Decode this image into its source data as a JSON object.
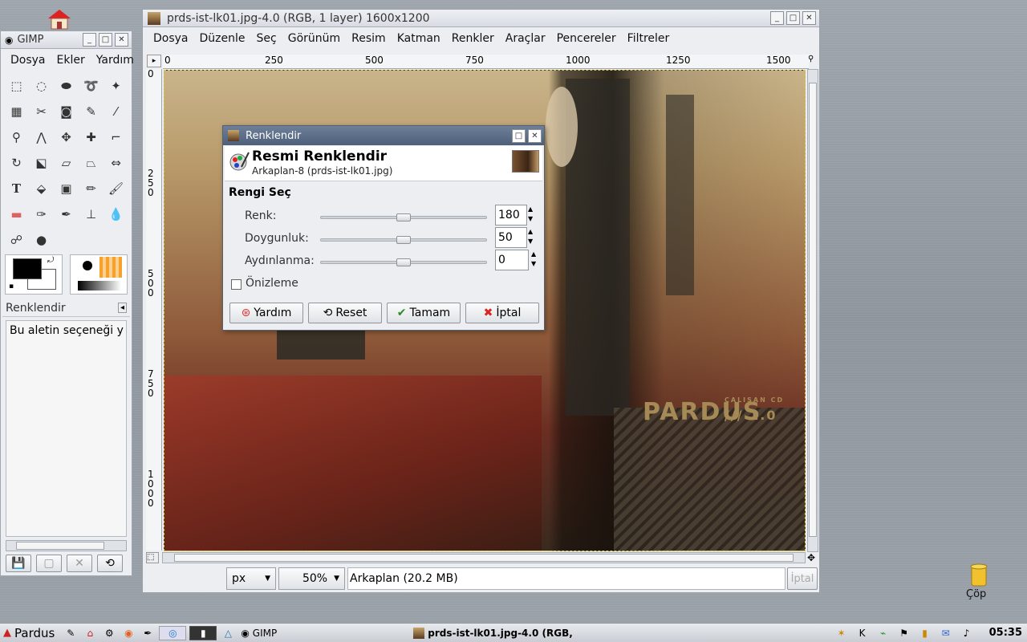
{
  "desktop": {
    "trash_label": "Çöp"
  },
  "toolbox": {
    "title": "GIMP",
    "menu": [
      "Dosya",
      "Ekler",
      "Yardım"
    ],
    "fg_color": "#000000",
    "bg_color": "#ffffff",
    "tool_options_title": "Renklendir",
    "tool_options_text": "Bu aletin seçeneği y"
  },
  "image_window": {
    "title": "prds-ist-lk01.jpg-4.0 (RGB, 1 layer) 1600x1200",
    "menu": [
      "Dosya",
      "Düzenle",
      "Seç",
      "Görünüm",
      "Resim",
      "Katman",
      "Renkler",
      "Araçlar",
      "Pencereler",
      "Filtreler"
    ],
    "ruler_h": [
      "0",
      "250",
      "500",
      "750",
      "1000",
      "1250",
      "1500"
    ],
    "ruler_v": [
      "0",
      "250",
      "500",
      "750",
      "1000"
    ],
    "unit": "px",
    "zoom": "50%",
    "status": "Arkaplan (20.2 MB)",
    "cancel": "İptal",
    "logo_text": "PARDUS",
    "logo_sub": "ÇALIŞAN CD",
    "logo_version": "/// 1.0"
  },
  "dialog": {
    "title": "Renklendir",
    "heading": "Resmi Renklendir",
    "subheading": "Arkaplan-8 (prds-ist-lk01.jpg)",
    "section": "Rengi Seç",
    "sliders": [
      {
        "label": "Renk:",
        "value": "180"
      },
      {
        "label": "Doygunluk:",
        "value": "50"
      },
      {
        "label": "Aydınlanma:",
        "value": "0"
      }
    ],
    "preview_label": "Önizleme",
    "buttons": {
      "help": "Yardım",
      "reset": "Reset",
      "ok": "Tamam",
      "cancel": "İptal"
    }
  },
  "taskbar": {
    "start": "Pardus",
    "gimp_task": "GIMP",
    "image_task": "prds-ist-lk01.jpg-4.0 (RGB,",
    "clock": "05:35"
  }
}
